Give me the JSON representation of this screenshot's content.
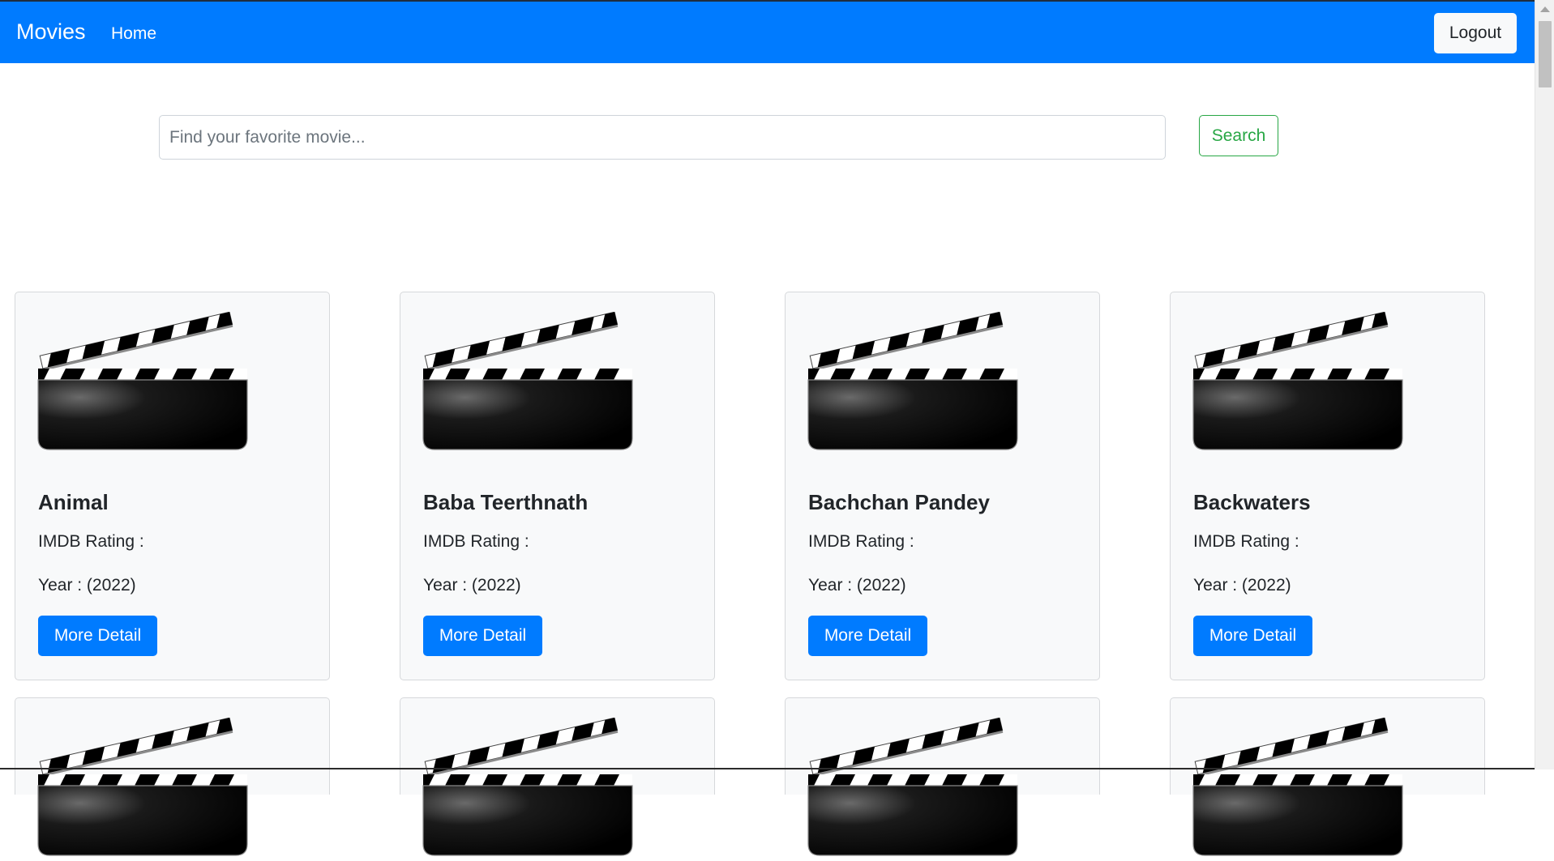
{
  "navbar": {
    "brand": "Movies",
    "home_label": "Home",
    "logout_label": "Logout",
    "background_color": "#007bff"
  },
  "search": {
    "placeholder": "Find your favorite movie...",
    "value": "",
    "button_label": "Search",
    "button_color": "#28a745"
  },
  "movies": [
    {
      "title": "Animal",
      "rating_label": "IMDB Rating :",
      "year_label": "Year : (2022)",
      "button_label": "More Detail",
      "icon": "clapperboard-icon"
    },
    {
      "title": "Baba Teerthnath",
      "rating_label": "IMDB Rating :",
      "year_label": "Year : (2022)",
      "button_label": "More Detail",
      "icon": "clapperboard-icon"
    },
    {
      "title": "Bachchan Pandey",
      "rating_label": "IMDB Rating :",
      "year_label": "Year : (2022)",
      "button_label": "More Detail",
      "icon": "clapperboard-icon"
    },
    {
      "title": "Backwaters",
      "rating_label": "IMDB Rating :",
      "year_label": "Year : (2022)",
      "button_label": "More Detail",
      "icon": "clapperboard-icon"
    }
  ],
  "next_row_partial_cards": 4
}
